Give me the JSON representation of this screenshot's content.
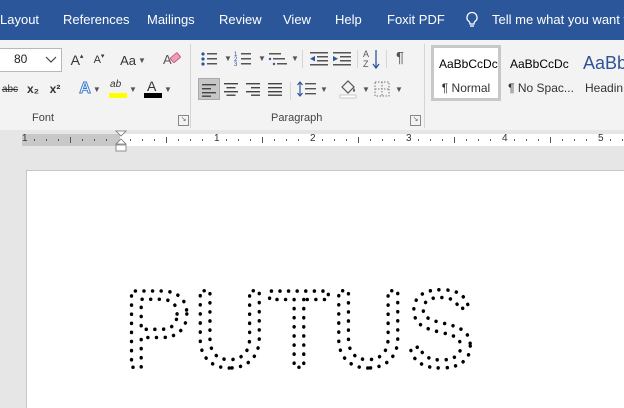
{
  "tabs": [
    "Layout",
    "References",
    "Mailings",
    "Review",
    "View",
    "Help",
    "Foxit PDF"
  ],
  "tell_me": "Tell me what you want to",
  "font": {
    "size": "80",
    "group_label": "Font",
    "grow_label": "A",
    "shrink_label": "A",
    "case_label": "Aa",
    "strike_label": "abc",
    "subscript_label": "x₂",
    "superscript_label": "x²",
    "effects_label": "A",
    "highlight_label": "ab",
    "color_label": "A",
    "highlight_color": "#ffff00",
    "font_color": "#000000"
  },
  "paragraph": {
    "group_label": "Paragraph",
    "pilcrow": "¶"
  },
  "styles": [
    {
      "sample": "AaBbCcDc",
      "name": "¶ Normal"
    },
    {
      "sample": "AaBbCcDc",
      "name": "¶ No Spac..."
    },
    {
      "sample": "AaBb",
      "name": "Headin"
    }
  ],
  "ruler": {
    "numbers": [
      "1",
      "1",
      "2",
      "3",
      "4",
      "5"
    ]
  },
  "document": {
    "text": "PUTUS"
  },
  "colors": {
    "title_bar": "#2b579a",
    "ribbon": "#f3f3f3",
    "heading_blue": "#2f5496"
  }
}
